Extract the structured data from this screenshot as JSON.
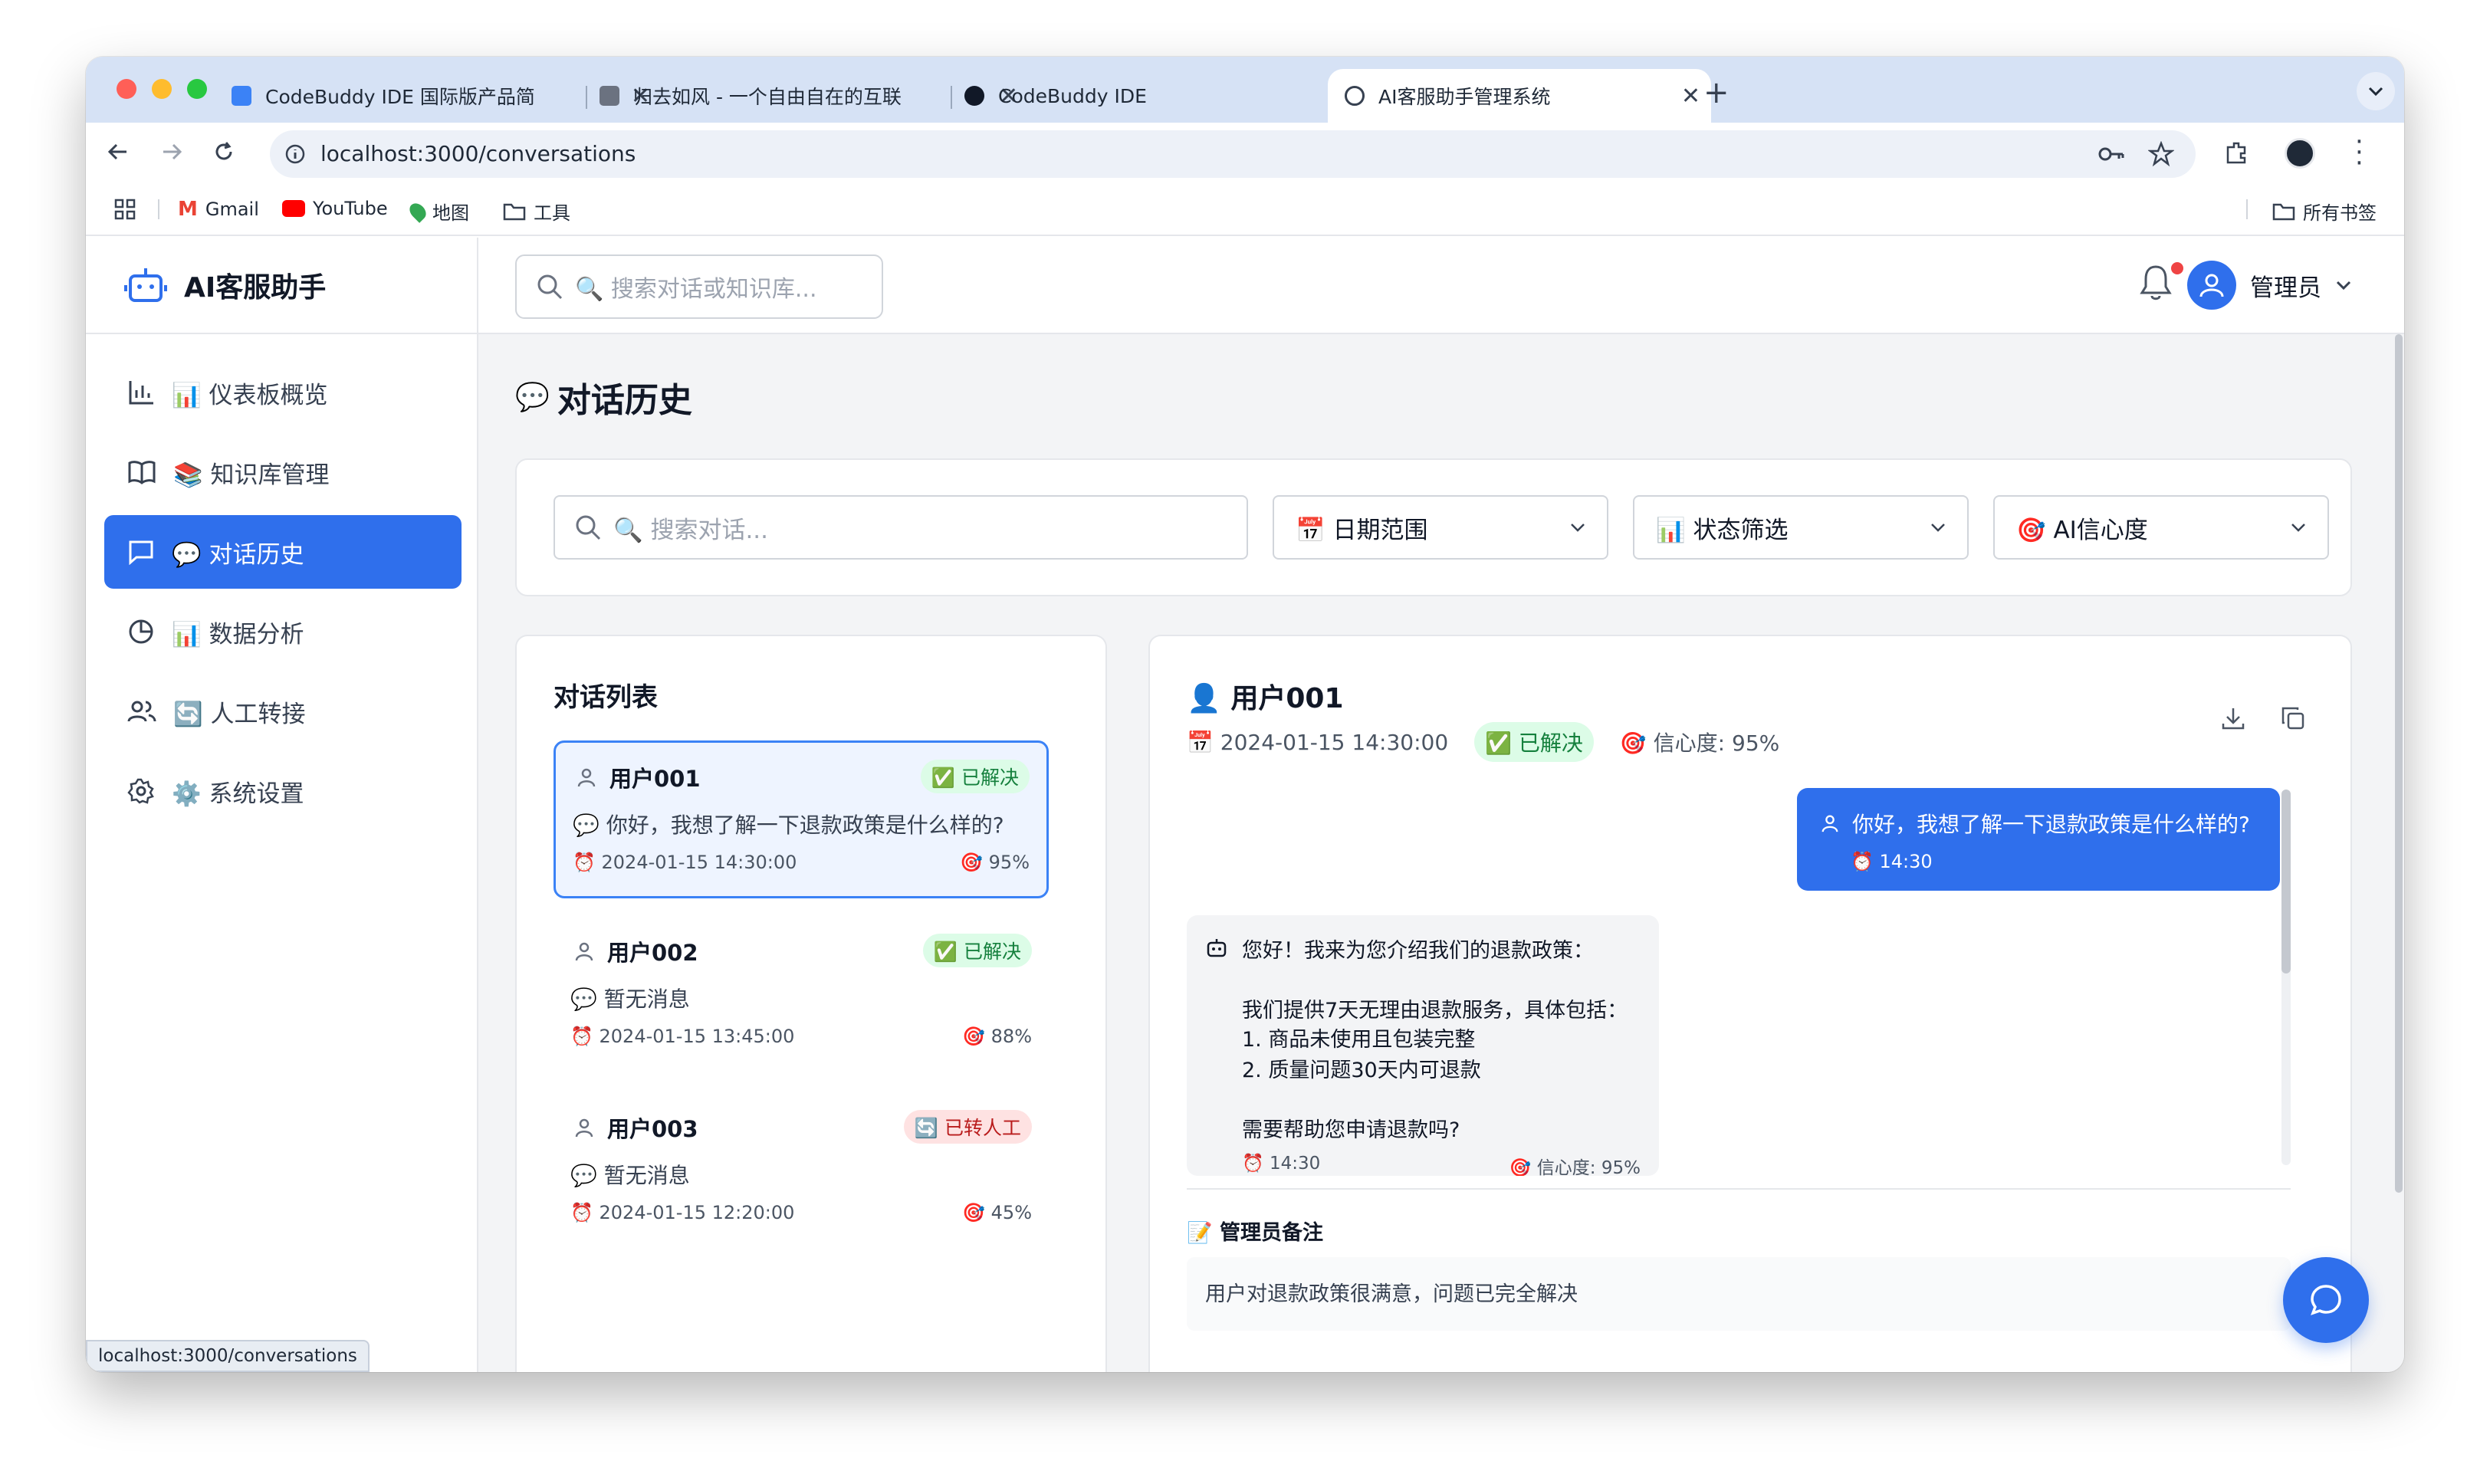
{
  "browser": {
    "tabs": [
      {
        "title": "CodeBuddy IDE 国际版产品简",
        "close": "✕"
      },
      {
        "title": "归去如风 - 一个自由自在的互联",
        "close": "✕"
      },
      {
        "title": "CodeBuddy IDE",
        "close": "✕"
      },
      {
        "title": "AI客服助手管理系统",
        "close": "✕"
      }
    ],
    "new_tab": "+",
    "url": "localhost:3000/conversations",
    "bookmarks": [
      "Gmail",
      "YouTube",
      "地图",
      "工具"
    ],
    "all_bookmarks": "所有书签",
    "status_url": "localhost:3000/conversations"
  },
  "app": {
    "brand": "AI客服助手",
    "search_placeholder": "🔍 搜索对话或知识库...",
    "user_name": "管理员",
    "nav": [
      {
        "label": "📊 仪表板概览",
        "icon": "bar-chart-icon"
      },
      {
        "label": "📚 知识库管理",
        "icon": "book-icon"
      },
      {
        "label": "💬 对话历史",
        "icon": "message-icon",
        "active": true
      },
      {
        "label": "📊 数据分析",
        "icon": "pie-chart-icon"
      },
      {
        "label": "🔄 人工转接",
        "icon": "users-icon"
      },
      {
        "label": "⚙️ 系统设置",
        "icon": "gear-icon"
      }
    ]
  },
  "page": {
    "title_emoji": "💬",
    "title": "对话历史",
    "filters": {
      "search_placeholder": "🔍 搜索对话...",
      "date": "📅 日期范围",
      "status": "📊 状态筛选",
      "confidence": "🎯 AI信心度"
    },
    "list_title": "对话列表",
    "conversations": [
      {
        "user": "用户001",
        "badge": "✅ 已解决",
        "message": "💬 你好，我想了解一下退款政策是什么样的?",
        "date": "⏰ 2024-01-15 14:30:00",
        "confidence": "🎯 95%"
      },
      {
        "user": "用户002",
        "badge": "✅ 已解决",
        "message": "💬 暂无消息",
        "date": "⏰ 2024-01-15 13:45:00",
        "confidence": "🎯 88%"
      },
      {
        "user": "用户003",
        "badge": "🔄 已转人工",
        "message": "💬 暂无消息",
        "date": "⏰ 2024-01-15 12:20:00",
        "confidence": "🎯 45%"
      }
    ],
    "detail": {
      "user": "👤 用户001",
      "date": "📅 2024-01-15 14:30:00",
      "badge": "✅ 已解决",
      "confidence": "🎯 信心度: 95%",
      "user_message": "你好，我想了解一下退款政策是什么样的?",
      "user_time": "⏰ 14:30",
      "ai_lines": [
        "您好！我来为您介绍我们的退款政策：",
        "我们提供7天无理由退款服务，具体包括：",
        "1. 商品未使用且包装完整",
        "2. 质量问题30天内可退款",
        "需要帮助您申请退款吗?"
      ],
      "ai_time": "⏰ 14:30",
      "ai_confidence": "🎯 信心度: 95%",
      "note_title": "📝 管理员备注",
      "note": "用户对退款政策很满意，问题已完全解决"
    }
  }
}
